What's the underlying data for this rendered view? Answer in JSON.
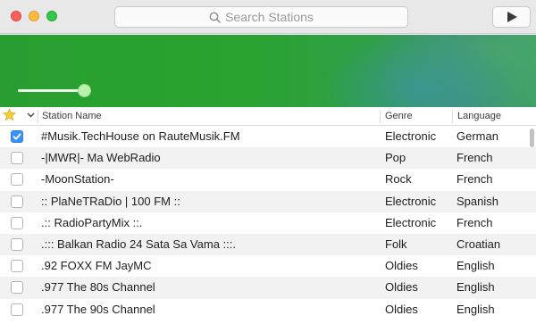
{
  "window": {
    "traffic_lights": [
      "close",
      "minimize",
      "maximize"
    ]
  },
  "toolbar": {
    "search_placeholder": "Search Stations",
    "search_icon": "search-icon",
    "play_icon": "play-icon"
  },
  "player": {
    "volume_level": 0.9
  },
  "table": {
    "columns": {
      "favorite_icon": "star-icon",
      "sort_icon": "chevron-down-icon",
      "name": "Station Name",
      "genre": "Genre",
      "language": "Language"
    },
    "rows": [
      {
        "checked": true,
        "name": "#Musik.TechHouse on RauteMusik.FM",
        "genre": "Electronic",
        "language": "German"
      },
      {
        "checked": false,
        "name": "-|MWR|- Ma WebRadio",
        "genre": "Pop",
        "language": "French"
      },
      {
        "checked": false,
        "name": "-MoonStation-",
        "genre": "Rock",
        "language": "French"
      },
      {
        "checked": false,
        "name": ":: PlaNeTRaDio | 100 FM ::",
        "genre": "Electronic",
        "language": "Spanish"
      },
      {
        "checked": false,
        "name": ".:: RadioPartyMix ::.",
        "genre": "Electronic",
        "language": "French"
      },
      {
        "checked": false,
        "name": ".::: Balkan Radio 24 Sata Sa Vama :::.",
        "genre": "Folk",
        "language": "Croatian"
      },
      {
        "checked": false,
        "name": ".92 FOXX FM JayMC",
        "genre": "Oldies",
        "language": "English"
      },
      {
        "checked": false,
        "name": ".977 The 80s Channel",
        "genre": "Oldies",
        "language": "English"
      },
      {
        "checked": false,
        "name": ".977 The 90s Channel",
        "genre": "Oldies",
        "language": "English"
      }
    ]
  },
  "colors": {
    "accent_green": "#2aa331",
    "checkbox_blue": "#3b92f5"
  }
}
